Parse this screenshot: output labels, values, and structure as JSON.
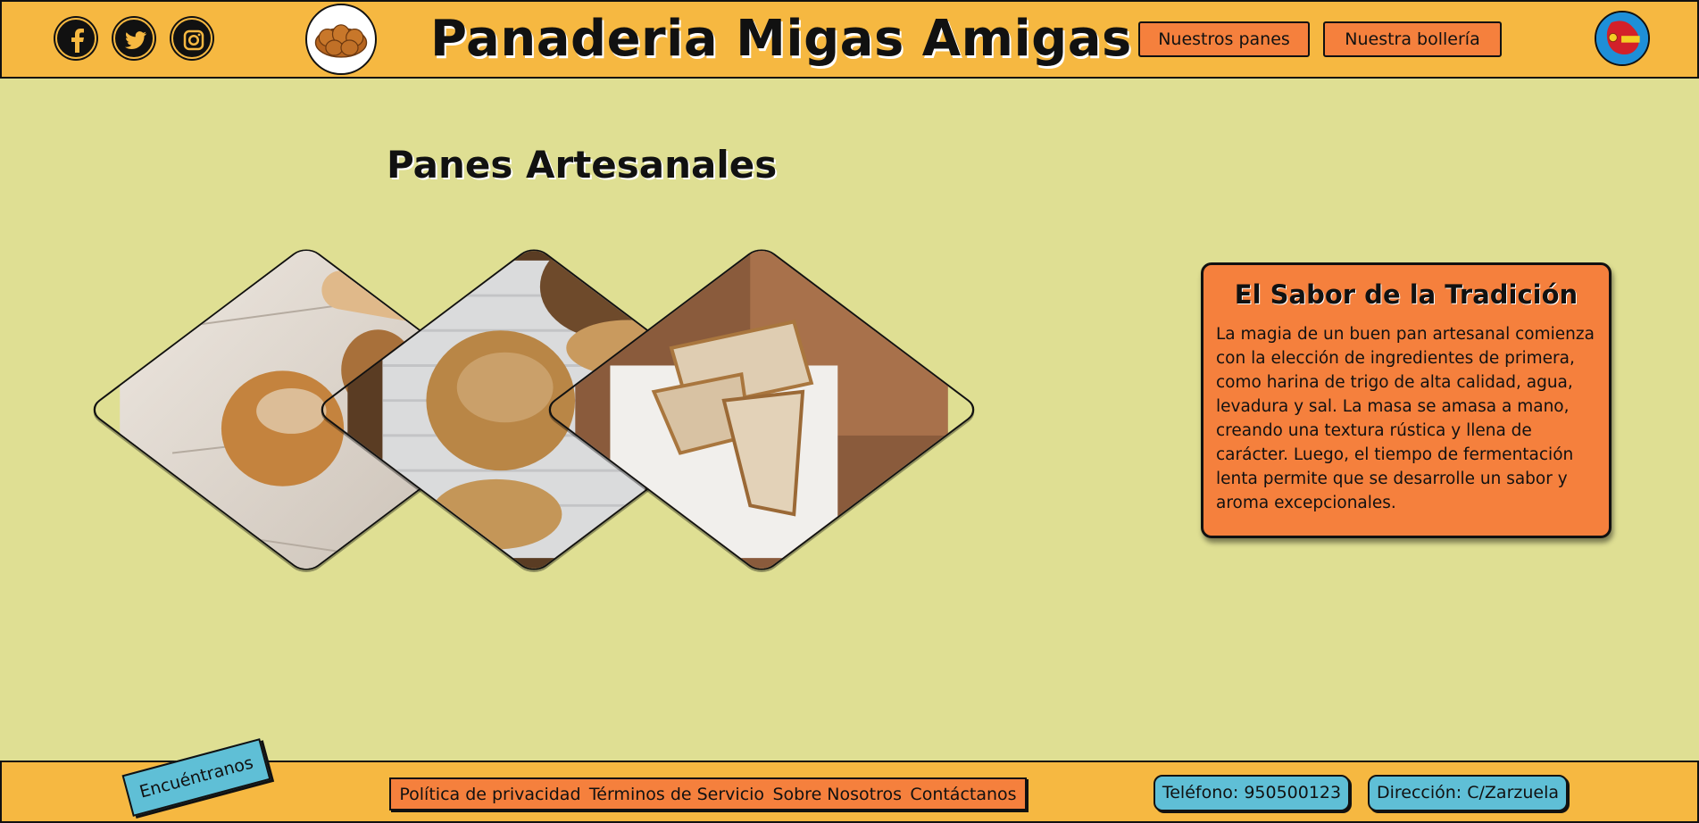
{
  "header": {
    "title": "Panaderia Migas Amigas",
    "social_icons": [
      "facebook-icon",
      "twitter-icon",
      "instagram-icon"
    ],
    "nav": [
      "Nuestros panes",
      "Nuestra bollería"
    ],
    "logo_icon": "bread-logo-icon",
    "language_icon": "spain-flag-icon"
  },
  "main": {
    "section_title": "Panes Artesanales",
    "gallery_images": [
      "rustic-breads-on-cloth",
      "sourdough-loaves-on-board",
      "sliced-bread-loaf"
    ],
    "info": {
      "title": "El Sabor de la Tradición",
      "text": "La magia de un buen pan artesanal comienza con la elección de ingredientes de primera, como harina de trigo de alta calidad, agua, levadura y sal. La masa se amasa a mano, creando una textura rústica y llena de carácter. Luego, el tiempo de fermentación lenta permite que se desarrolle un sabor y aroma excepcionales."
    }
  },
  "footer": {
    "find_us": "Encuéntranos",
    "links": [
      "Política de privacidad",
      "Términos de Servicio",
      "Sobre Nosotros",
      "Contáctanos"
    ],
    "phone": "Teléfono: 950500123",
    "address": "Dirección: C/Zarzuela"
  },
  "colors": {
    "header_bg": "#f6b841",
    "page_bg": "#dfdf93",
    "accent_orange": "#f5803d",
    "accent_blue": "#5fbfd6"
  }
}
